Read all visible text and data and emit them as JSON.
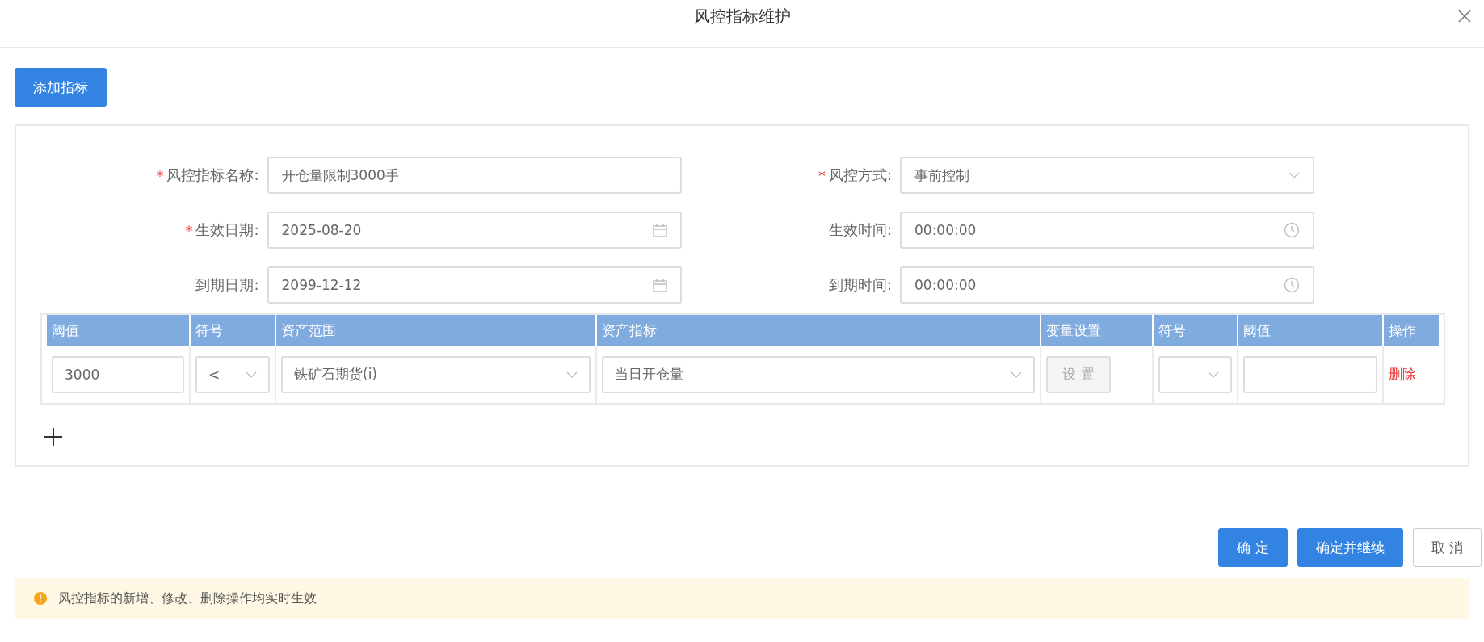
{
  "window": {
    "title": "风控指标维护"
  },
  "add_button": "添加指标",
  "form": {
    "required_mark": "*",
    "fields": [
      {
        "label": "风控指标名称:",
        "required": true,
        "kind": "text",
        "value": "开仓量限制3000手"
      },
      {
        "label": "风控方式:",
        "required": true,
        "kind": "select",
        "value": "事前控制"
      },
      {
        "label": "生效日期:",
        "required": true,
        "kind": "date",
        "value": "2025-08-20"
      },
      {
        "label": "生效时间:",
        "required": false,
        "kind": "time",
        "value": "00:00:00"
      },
      {
        "label": "到期日期:",
        "required": false,
        "kind": "date",
        "value": "2099-12-12"
      },
      {
        "label": "到期时间:",
        "required": false,
        "kind": "time",
        "value": "00:00:00"
      }
    ]
  },
  "table": {
    "columns": [
      "阈值",
      "符号",
      "资产范围",
      "资产指标",
      "变量设置",
      "符号",
      "阈值",
      "操作"
    ],
    "rows": [
      {
        "cells": [
          {
            "kind": "input",
            "value": "3000"
          },
          {
            "kind": "select",
            "value": "<"
          },
          {
            "kind": "select",
            "value": "铁矿石期货(i)"
          },
          {
            "kind": "select",
            "value": "当日开仓量"
          },
          {
            "kind": "button",
            "label": "设 置",
            "disabled": true
          },
          {
            "kind": "select"
          },
          {
            "kind": "input"
          },
          {
            "kind": "link",
            "label": "删除"
          }
        ]
      }
    ]
  },
  "footer_buttons": [
    {
      "label": "确 定",
      "kind": "primary"
    },
    {
      "label": "确定并继续",
      "kind": "primary"
    },
    {
      "label": "取 消",
      "kind": "default"
    }
  ],
  "notice": {
    "text": "风控指标的新增、修改、删除操作均实时生效"
  }
}
